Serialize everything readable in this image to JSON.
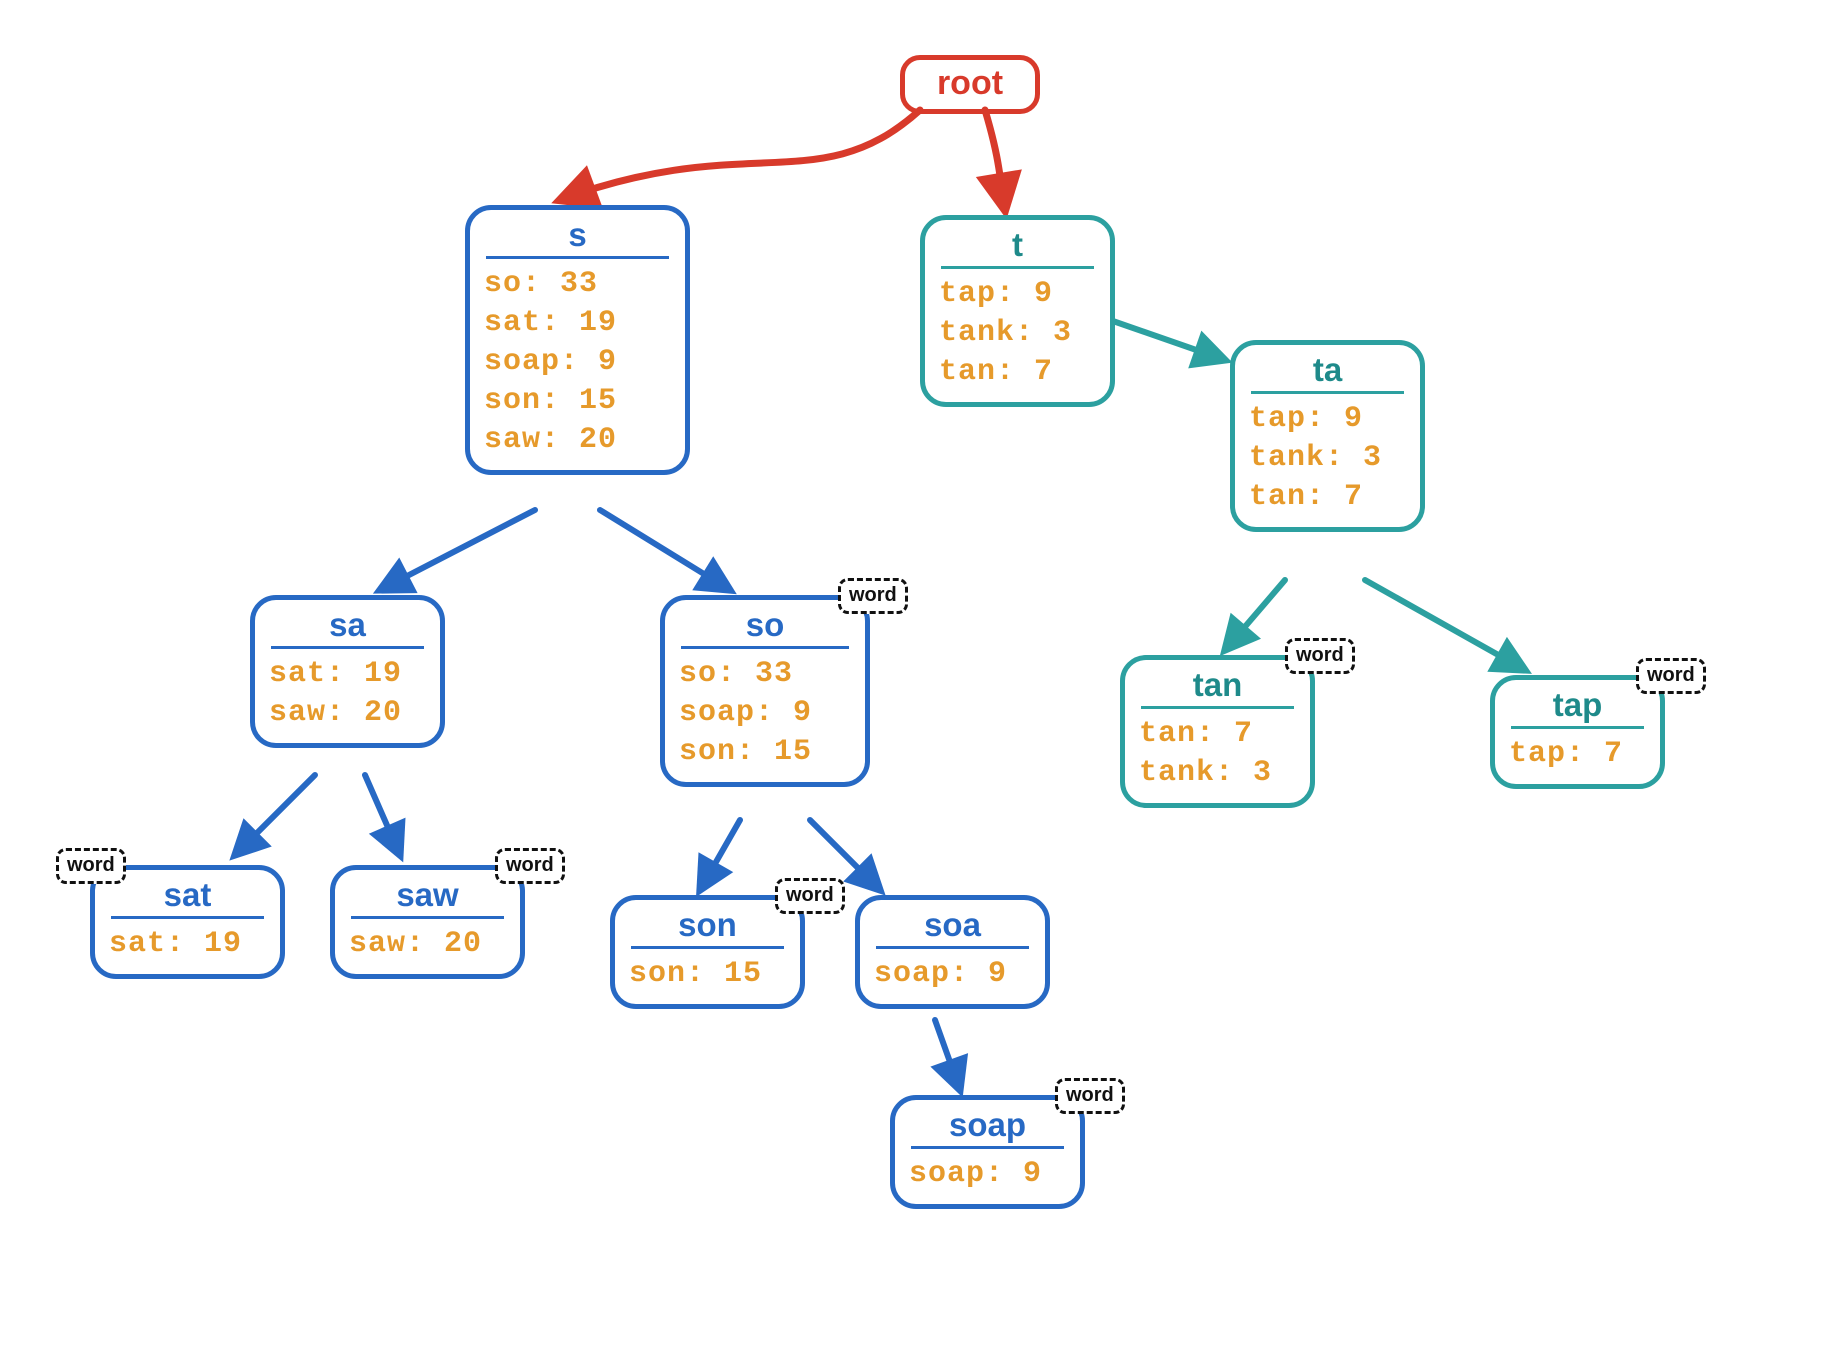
{
  "colors": {
    "red": "#D83A2B",
    "blue": "#2769C4",
    "teal": "#2CA0A0",
    "orange": "#E69A2B"
  },
  "root": {
    "label": "root"
  },
  "wordBadge": "word",
  "nodes": {
    "s": {
      "title": "s",
      "entries": [
        {
          "k": "so",
          "v": 33
        },
        {
          "k": "sat",
          "v": 19
        },
        {
          "k": "soap",
          "v": 9
        },
        {
          "k": "son",
          "v": 15
        },
        {
          "k": "saw",
          "v": 20
        }
      ]
    },
    "t": {
      "title": "t",
      "entries": [
        {
          "k": "tap",
          "v": 9
        },
        {
          "k": "tank",
          "v": 3
        },
        {
          "k": "tan",
          "v": 7
        }
      ]
    },
    "ta": {
      "title": "ta",
      "entries": [
        {
          "k": "tap",
          "v": 9
        },
        {
          "k": "tank",
          "v": 3
        },
        {
          "k": "tan",
          "v": 7
        }
      ]
    },
    "sa": {
      "title": "sa",
      "entries": [
        {
          "k": "sat",
          "v": 19
        },
        {
          "k": "saw",
          "v": 20
        }
      ]
    },
    "so": {
      "title": "so",
      "wordBadge": true,
      "entries": [
        {
          "k": "so",
          "v": 33
        },
        {
          "k": "soap",
          "v": 9
        },
        {
          "k": "son",
          "v": 15
        }
      ]
    },
    "tan": {
      "title": "tan",
      "wordBadge": true,
      "entries": [
        {
          "k": "tan",
          "v": 7
        },
        {
          "k": "tank",
          "v": 3
        }
      ]
    },
    "tap": {
      "title": "tap",
      "wordBadge": true,
      "entries": [
        {
          "k": "tap",
          "v": 7
        }
      ]
    },
    "sat": {
      "title": "sat",
      "wordBadge": true,
      "entries": [
        {
          "k": "sat",
          "v": 19
        }
      ]
    },
    "saw": {
      "title": "saw",
      "wordBadge": true,
      "entries": [
        {
          "k": "saw",
          "v": 20
        }
      ]
    },
    "son": {
      "title": "son",
      "wordBadge": true,
      "entries": [
        {
          "k": "son",
          "v": 15
        }
      ]
    },
    "soa": {
      "title": "soa",
      "entries": [
        {
          "k": "soap",
          "v": 9
        }
      ]
    },
    "soap": {
      "title": "soap",
      "wordBadge": true,
      "entries": [
        {
          "k": "soap",
          "v": 9
        }
      ]
    }
  },
  "edges": [
    {
      "color": "red",
      "from": "root",
      "to": "s"
    },
    {
      "color": "red",
      "from": "root",
      "to": "t"
    },
    {
      "color": "blue",
      "from": "s",
      "to": "sa"
    },
    {
      "color": "blue",
      "from": "s",
      "to": "so"
    },
    {
      "color": "teal",
      "from": "t",
      "to": "ta"
    },
    {
      "color": "blue",
      "from": "sa",
      "to": "sat"
    },
    {
      "color": "blue",
      "from": "sa",
      "to": "saw"
    },
    {
      "color": "blue",
      "from": "so",
      "to": "son"
    },
    {
      "color": "blue",
      "from": "so",
      "to": "soa"
    },
    {
      "color": "teal",
      "from": "ta",
      "to": "tan"
    },
    {
      "color": "teal",
      "from": "ta",
      "to": "tap"
    },
    {
      "color": "blue",
      "from": "soa",
      "to": "soap"
    }
  ]
}
